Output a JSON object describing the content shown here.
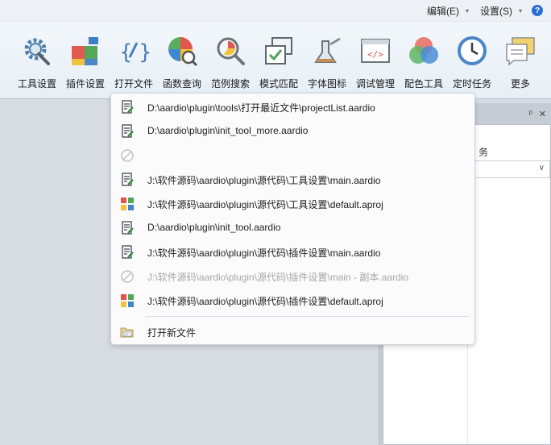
{
  "menubar": {
    "edit_label": "编辑(E)",
    "settings_label": "设置(S)",
    "help_glyph": "?"
  },
  "ribbon": {
    "tools": [
      {
        "label": "工具设置",
        "icon": "gear-wrench-icon"
      },
      {
        "label": "插件设置",
        "icon": "puzzle-icon"
      },
      {
        "label": "打开文件",
        "icon": "code-brace-icon"
      },
      {
        "label": "函数查询",
        "icon": "pie-search-icon"
      },
      {
        "label": "范例搜索",
        "icon": "magnifier-chart-icon"
      },
      {
        "label": "模式匹配",
        "icon": "pattern-match-icon"
      },
      {
        "label": "字体图标",
        "icon": "flask-icon"
      },
      {
        "label": "调试管理",
        "icon": "code-window-icon"
      },
      {
        "label": "配色工具",
        "icon": "color-circles-icon"
      },
      {
        "label": "定时任务",
        "icon": "clock-icon"
      },
      {
        "label": "更多",
        "icon": "chat-bubbles-icon"
      }
    ]
  },
  "dock": {
    "pin_glyph": "ᵖ",
    "close_glyph": "✕",
    "fragment_text": "务"
  },
  "recent_files": {
    "items": [
      {
        "text": "D:\\aardio\\plugin\\tools\\打开最近文件\\projectList.aardio",
        "icon": "aardio-file-icon",
        "disabled": false
      },
      {
        "text": "D:\\aardio\\plugin\\init_tool_more.aardio",
        "icon": "aardio-file-icon",
        "disabled": false
      },
      {
        "text": "",
        "icon": "disabled-icon",
        "disabled": true
      },
      {
        "text": "J:\\软件源码\\aardio\\plugin\\源代码\\工具设置\\main.aardio",
        "icon": "aardio-file-icon",
        "disabled": false
      },
      {
        "text": "J:\\软件源码\\aardio\\plugin\\源代码\\工具设置\\default.aproj",
        "icon": "project-file-icon",
        "disabled": false
      },
      {
        "text": "D:\\aardio\\plugin\\init_tool.aardio",
        "icon": "aardio-file-icon",
        "disabled": false
      },
      {
        "text": "J:\\软件源码\\aardio\\plugin\\源代码\\插件设置\\main.aardio",
        "icon": "aardio-file-icon",
        "disabled": false
      },
      {
        "text": "J:\\软件源码\\aardio\\plugin\\源代码\\插件设置\\main - 副本.aardio",
        "icon": "disabled-icon",
        "disabled": true
      },
      {
        "text": "J:\\软件源码\\aardio\\plugin\\源代码\\插件设置\\default.aproj",
        "icon": "project-file-icon",
        "disabled": false
      }
    ],
    "open_new_label": "打开新文件",
    "open_new_icon": "open-folder-icon"
  }
}
